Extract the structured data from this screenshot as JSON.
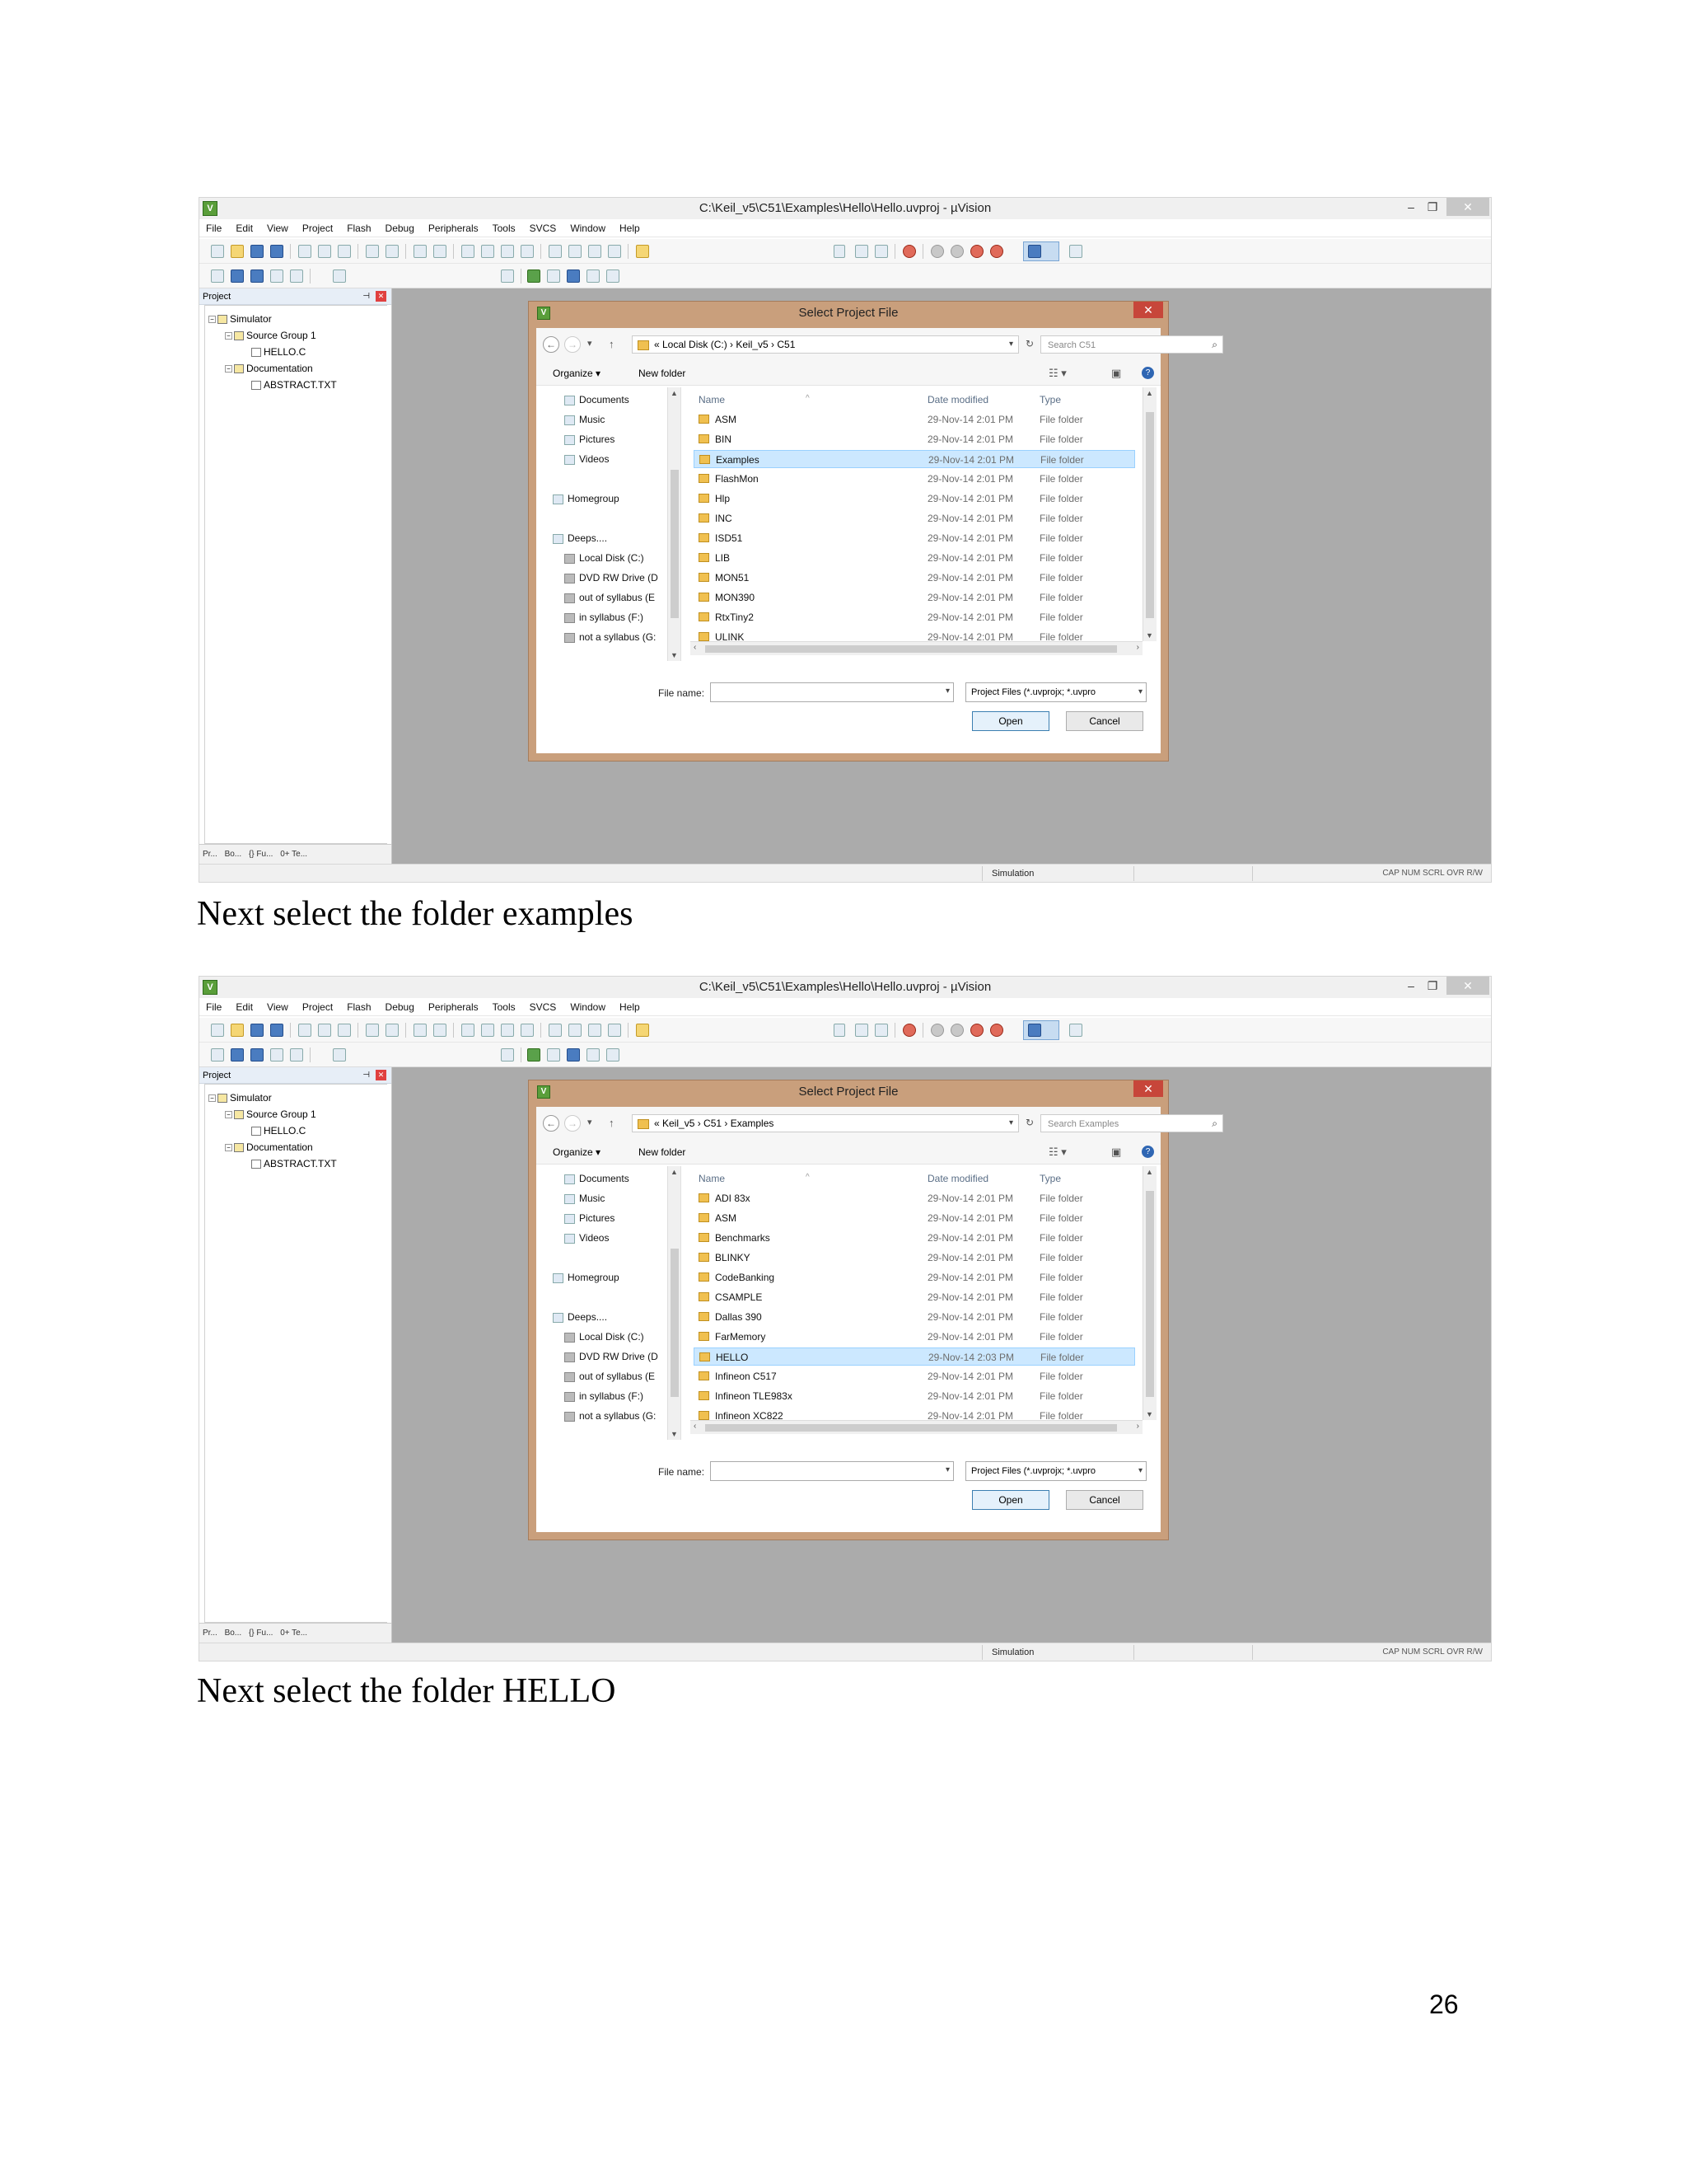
{
  "screens": [
    {
      "window_title": "C:\\Keil_v5\\C51\\Examples\\Hello\\Hello.uvproj - µVision",
      "menu": [
        "File",
        "Edit",
        "View",
        "Project",
        "Flash",
        "Debug",
        "Peripherals",
        "Tools",
        "SVCS",
        "Window",
        "Help"
      ],
      "target_select": "Simulator",
      "panel_title": "Project",
      "tree": [
        {
          "label": "Simulator",
          "indent": 0
        },
        {
          "label": "Source Group 1",
          "indent": 1
        },
        {
          "label": "HELLO.C",
          "indent": 2
        },
        {
          "label": "Documentation",
          "indent": 1
        },
        {
          "label": "ABSTRACT.TXT",
          "indent": 2
        }
      ],
      "panel_tabs": [
        "Pr...",
        "Bo...",
        "{} Fu...",
        "0+ Te..."
      ],
      "status_text": "Simulation",
      "status_caps": "CAP  NUM  SCRL  OVR  R/W",
      "dialog": {
        "title": "Select Project File",
        "breadcrumb": "«  Local Disk (C:)  ›  Keil_v5  ›  C51",
        "search_placeholder": "Search C51",
        "organize": "Organize ▾",
        "new_folder": "New folder",
        "nav": [
          "Documents",
          "Music",
          "Pictures",
          "Videos",
          "Homegroup",
          "Deeps....",
          "Local Disk (C:)",
          "DVD RW Drive (D",
          "out of syllabus (E",
          "in syllabus (F:)",
          "not a syllabus (G:"
        ],
        "columns": [
          "Name",
          "Date modified",
          "Type"
        ],
        "files": [
          {
            "name": "ASM",
            "date": "29-Nov-14 2:01 PM",
            "type": "File folder"
          },
          {
            "name": "BIN",
            "date": "29-Nov-14 2:01 PM",
            "type": "File folder"
          },
          {
            "name": "Examples",
            "date": "29-Nov-14 2:01 PM",
            "type": "File folder",
            "selected": true
          },
          {
            "name": "FlashMon",
            "date": "29-Nov-14 2:01 PM",
            "type": "File folder"
          },
          {
            "name": "Hlp",
            "date": "29-Nov-14 2:01 PM",
            "type": "File folder"
          },
          {
            "name": "INC",
            "date": "29-Nov-14 2:01 PM",
            "type": "File folder"
          },
          {
            "name": "ISD51",
            "date": "29-Nov-14 2:01 PM",
            "type": "File folder"
          },
          {
            "name": "LIB",
            "date": "29-Nov-14 2:01 PM",
            "type": "File folder"
          },
          {
            "name": "MON51",
            "date": "29-Nov-14 2:01 PM",
            "type": "File folder"
          },
          {
            "name": "MON390",
            "date": "29-Nov-14 2:01 PM",
            "type": "File folder"
          },
          {
            "name": "RtxTiny2",
            "date": "29-Nov-14 2:01 PM",
            "type": "File folder"
          },
          {
            "name": "ULINK",
            "date": "29-Nov-14 2:01 PM",
            "type": "File folder"
          }
        ],
        "filename_label": "File name:",
        "filename_value": "",
        "filter": "Project Files (*.uvprojx; *.uvpro",
        "open": "Open",
        "cancel": "Cancel"
      }
    },
    {
      "window_title": "C:\\Keil_v5\\C51\\Examples\\Hello\\Hello.uvproj - µVision",
      "menu": [
        "File",
        "Edit",
        "View",
        "Project",
        "Flash",
        "Debug",
        "Peripherals",
        "Tools",
        "SVCS",
        "Window",
        "Help"
      ],
      "target_select": "Simulator",
      "panel_title": "Project",
      "tree": [
        {
          "label": "Simulator",
          "indent": 0
        },
        {
          "label": "Source Group 1",
          "indent": 1
        },
        {
          "label": "HELLO.C",
          "indent": 2
        },
        {
          "label": "Documentation",
          "indent": 1
        },
        {
          "label": "ABSTRACT.TXT",
          "indent": 2
        }
      ],
      "panel_tabs": [
        "Pr...",
        "Bo...",
        "{} Fu...",
        "0+ Te..."
      ],
      "status_text": "Simulation",
      "status_caps": "CAP  NUM  SCRL  OVR  R/W",
      "dialog": {
        "title": "Select Project File",
        "breadcrumb": "«  Keil_v5  ›  C51  ›  Examples",
        "search_placeholder": "Search Examples",
        "organize": "Organize ▾",
        "new_folder": "New folder",
        "nav": [
          "Documents",
          "Music",
          "Pictures",
          "Videos",
          "Homegroup",
          "Deeps....",
          "Local Disk (C:)",
          "DVD RW Drive (D",
          "out of syllabus (E",
          "in syllabus (F:)",
          "not a syllabus (G:"
        ],
        "columns": [
          "Name",
          "Date modified",
          "Type"
        ],
        "files": [
          {
            "name": "ADI 83x",
            "date": "29-Nov-14 2:01 PM",
            "type": "File folder"
          },
          {
            "name": "ASM",
            "date": "29-Nov-14 2:01 PM",
            "type": "File folder"
          },
          {
            "name": "Benchmarks",
            "date": "29-Nov-14 2:01 PM",
            "type": "File folder"
          },
          {
            "name": "BLINKY",
            "date": "29-Nov-14 2:01 PM",
            "type": "File folder"
          },
          {
            "name": "CodeBanking",
            "date": "29-Nov-14 2:01 PM",
            "type": "File folder"
          },
          {
            "name": "CSAMPLE",
            "date": "29-Nov-14 2:01 PM",
            "type": "File folder"
          },
          {
            "name": "Dallas 390",
            "date": "29-Nov-14 2:01 PM",
            "type": "File folder"
          },
          {
            "name": "FarMemory",
            "date": "29-Nov-14 2:01 PM",
            "type": "File folder"
          },
          {
            "name": "HELLO",
            "date": "29-Nov-14 2:03 PM",
            "type": "File folder",
            "selected": true
          },
          {
            "name": "Infineon C517",
            "date": "29-Nov-14 2:01 PM",
            "type": "File folder"
          },
          {
            "name": "Infineon TLE983x",
            "date": "29-Nov-14 2:01 PM",
            "type": "File folder"
          },
          {
            "name": "Infineon XC822",
            "date": "29-Nov-14 2:01 PM",
            "type": "File folder"
          }
        ],
        "filename_label": "File name:",
        "filename_value": "",
        "filter": "Project Files (*.uvprojx; *.uvpro",
        "open": "Open",
        "cancel": "Cancel"
      }
    }
  ],
  "captions": [
    "Next select the folder examples",
    "Next select the folder HELLO"
  ],
  "page_number": "26"
}
